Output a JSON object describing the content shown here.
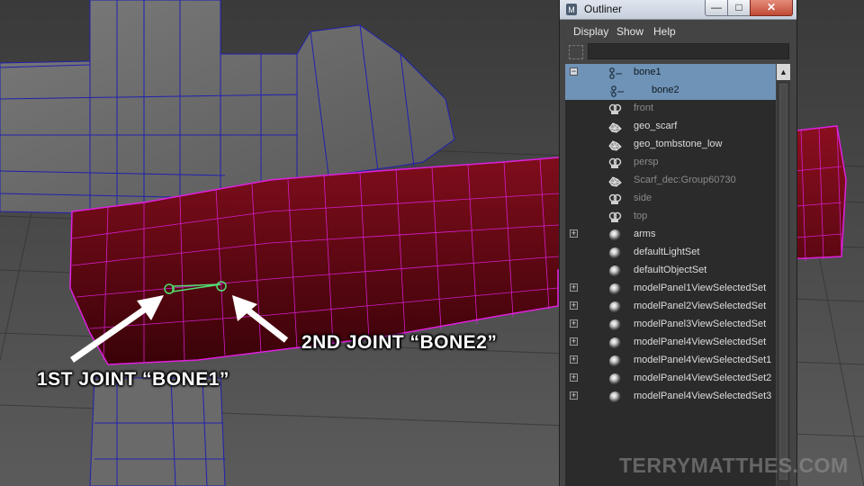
{
  "viewport": {
    "callout_bone1": "1ST JOINT “BONE1”",
    "callout_bone2": "2ND JOINT “BONE2”",
    "watermark": "TERRYMATTHES.COM"
  },
  "colors": {
    "selection": "#6f93b6",
    "scarf_wire": "#e020e0",
    "scarf_fill": "#6a0a16",
    "stone_fill": "#6b6b6b",
    "stone_wire": "#1a1aa8",
    "joint": "#50e070"
  },
  "outliner": {
    "title": "Outliner",
    "window_buttons": {
      "minimize": "—",
      "maximize": "□",
      "close": "✕"
    },
    "menu": {
      "display": "Display",
      "show": "Show",
      "help": "Help"
    },
    "filter_value": "",
    "items": [
      {
        "label": "bone1",
        "type": "joint",
        "selected": true,
        "expander": "−"
      },
      {
        "label": "bone2",
        "type": "joint-child",
        "selected": true
      },
      {
        "label": "front",
        "type": "camera",
        "dim": true
      },
      {
        "label": "geo_scarf",
        "type": "mesh"
      },
      {
        "label": "geo_tombstone_low",
        "type": "mesh"
      },
      {
        "label": "persp",
        "type": "camera",
        "dim": true
      },
      {
        "label": "Scarf_dec:Group60730",
        "type": "mesh",
        "dim": true
      },
      {
        "label": "side",
        "type": "camera",
        "dim": true
      },
      {
        "label": "top",
        "type": "camera",
        "dim": true
      },
      {
        "label": "arms",
        "type": "set",
        "expander": "+"
      },
      {
        "label": "defaultLightSet",
        "type": "set"
      },
      {
        "label": "defaultObjectSet",
        "type": "set"
      },
      {
        "label": "modelPanel1ViewSelectedSet",
        "type": "set",
        "expander": "+"
      },
      {
        "label": "modelPanel2ViewSelectedSet",
        "type": "set",
        "expander": "+"
      },
      {
        "label": "modelPanel3ViewSelectedSet",
        "type": "set",
        "expander": "+"
      },
      {
        "label": "modelPanel4ViewSelectedSet",
        "type": "set",
        "expander": "+"
      },
      {
        "label": "modelPanel4ViewSelectedSet1",
        "type": "set",
        "expander": "+"
      },
      {
        "label": "modelPanel4ViewSelectedSet2",
        "type": "set",
        "expander": "+"
      },
      {
        "label": "modelPanel4ViewSelectedSet3",
        "type": "set",
        "expander": "+"
      }
    ]
  }
}
